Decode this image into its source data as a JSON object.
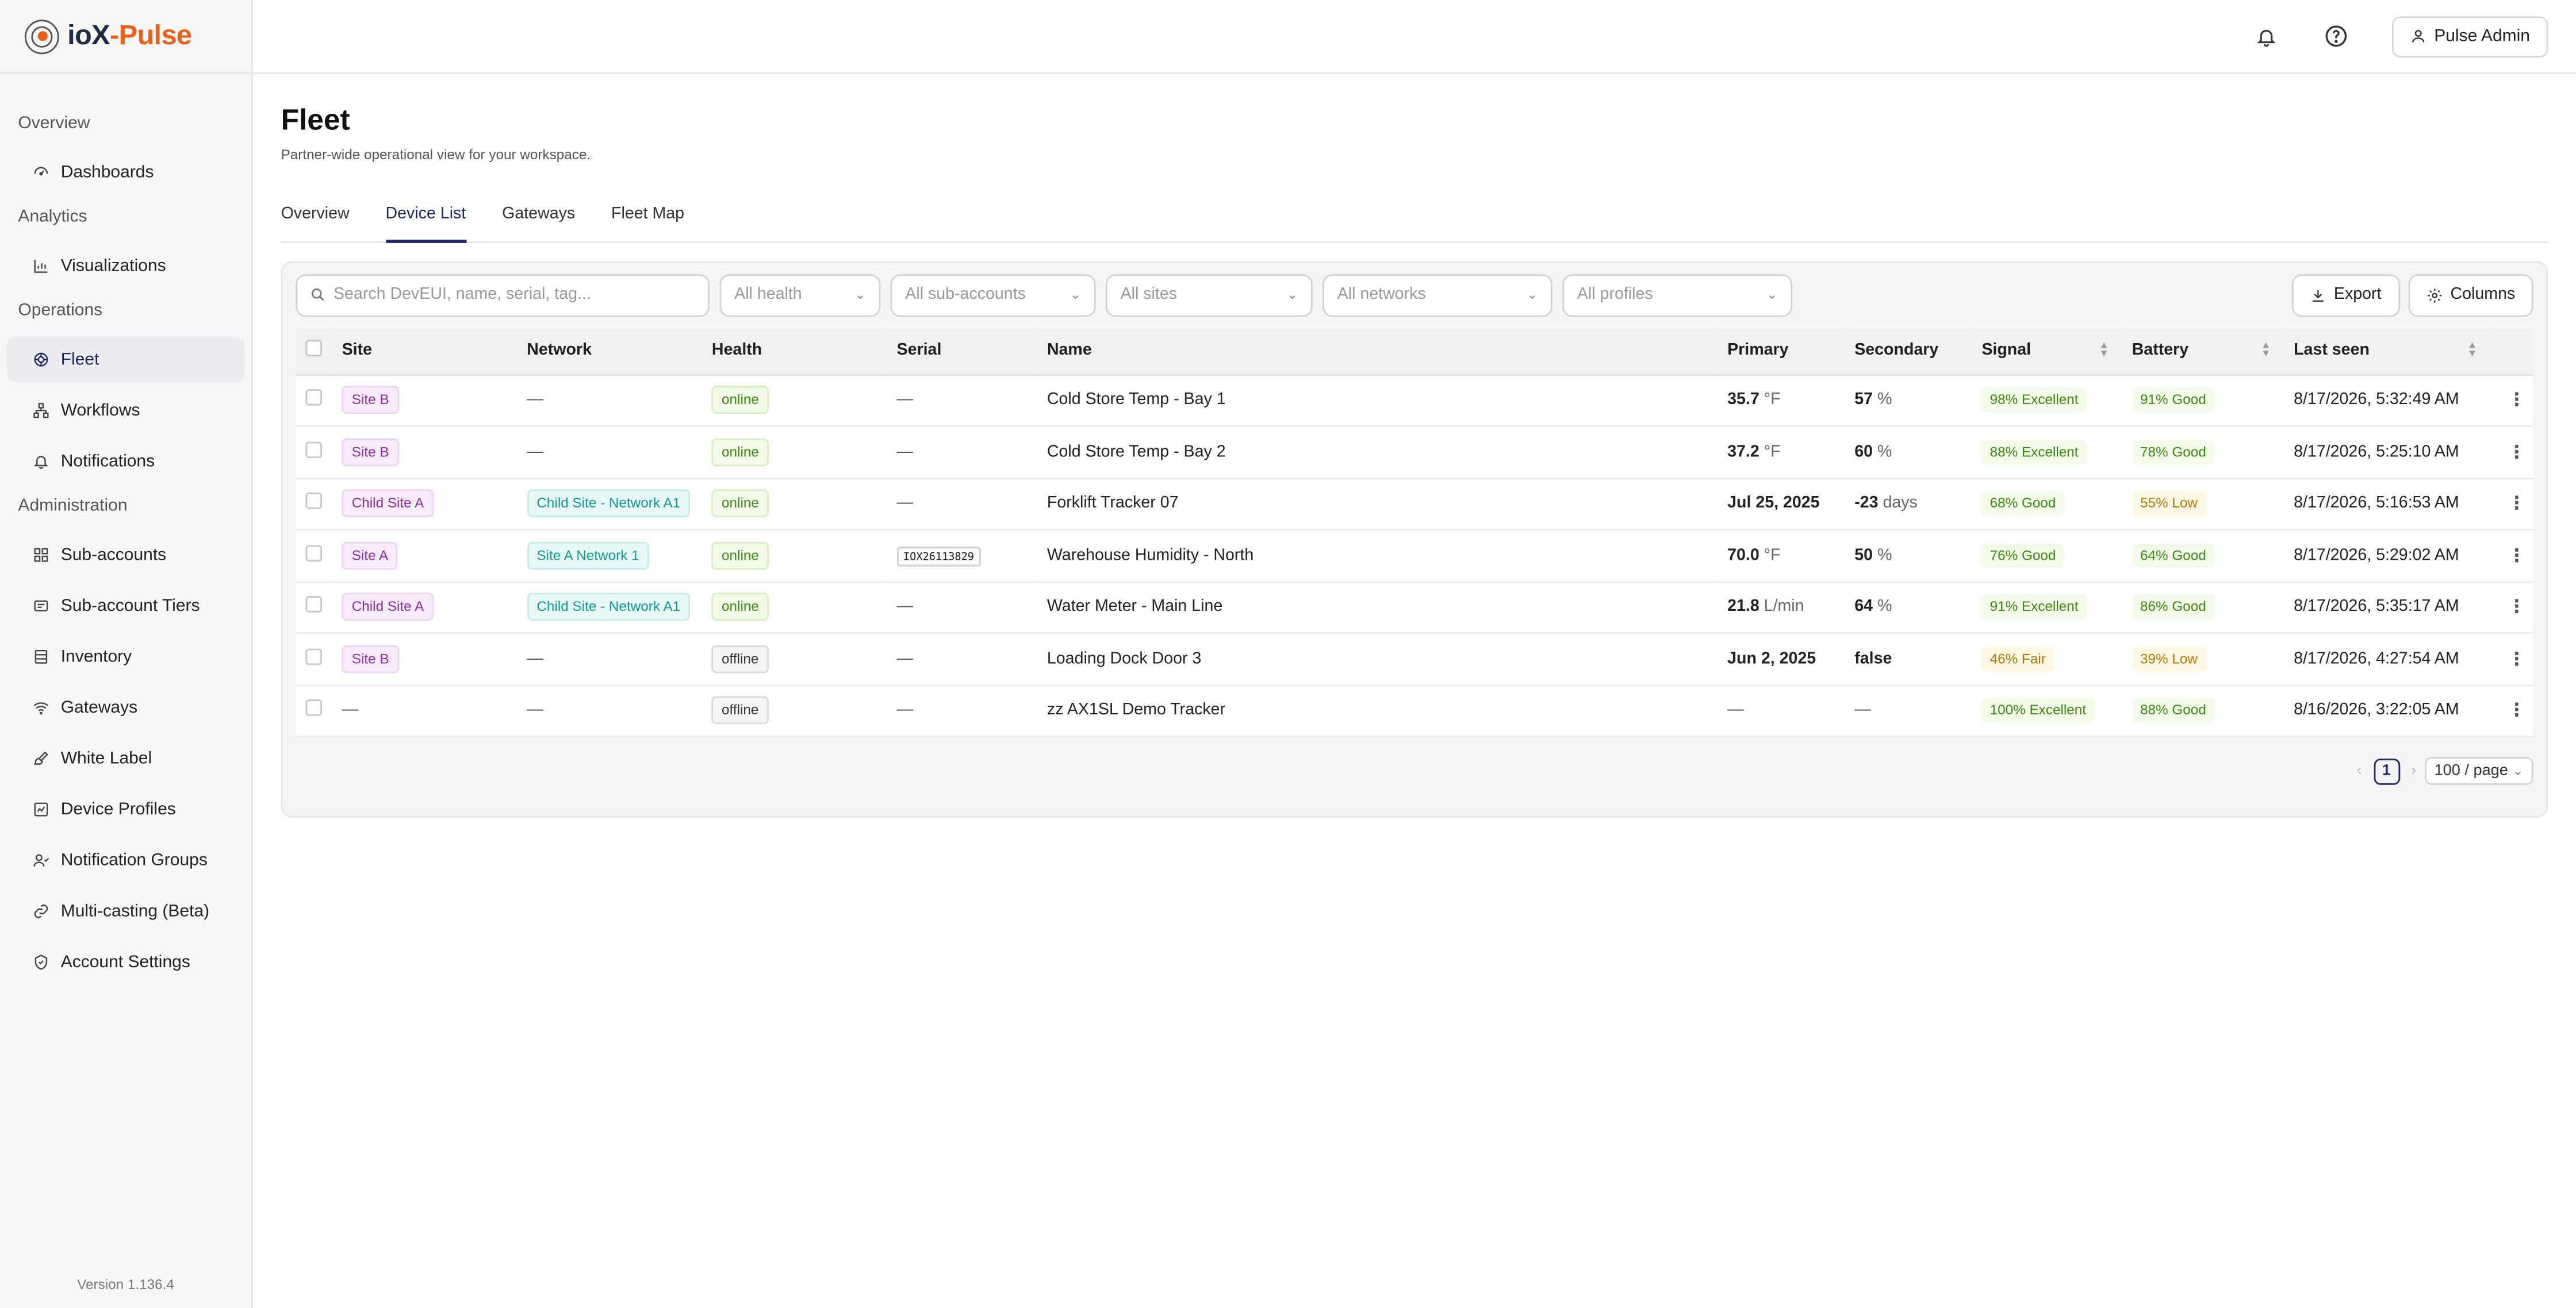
{
  "brand": {
    "part1": "ioX",
    "part2": "-Pulse"
  },
  "sidebar": {
    "sections": [
      {
        "title": "Overview",
        "items": [
          {
            "label": "Dashboards",
            "icon": "dashboard-icon"
          }
        ]
      },
      {
        "title": "Analytics",
        "items": [
          {
            "label": "Visualizations",
            "icon": "chart-icon"
          }
        ]
      },
      {
        "title": "Operations",
        "items": [
          {
            "label": "Fleet",
            "icon": "fleet-icon",
            "active": true
          },
          {
            "label": "Workflows",
            "icon": "workflow-icon"
          },
          {
            "label": "Notifications",
            "icon": "bell-icon"
          }
        ]
      },
      {
        "title": "Administration",
        "items": [
          {
            "label": "Sub-accounts",
            "icon": "grid-icon"
          },
          {
            "label": "Sub-account Tiers",
            "icon": "tiers-icon"
          },
          {
            "label": "Inventory",
            "icon": "inventory-icon"
          },
          {
            "label": "Gateways",
            "icon": "wifi-icon"
          },
          {
            "label": "White Label",
            "icon": "brush-icon"
          },
          {
            "label": "Device Profiles",
            "icon": "profile-icon"
          },
          {
            "label": "Notification Groups",
            "icon": "group-icon"
          },
          {
            "label": "Multi-casting (Beta)",
            "icon": "link-icon"
          },
          {
            "label": "Account Settings",
            "icon": "shield-icon"
          }
        ]
      }
    ],
    "version": "Version 1.136.4"
  },
  "topbar": {
    "user": "Pulse Admin"
  },
  "page": {
    "title": "Fleet",
    "subtitle": "Partner-wide operational view for your workspace."
  },
  "tabs": [
    {
      "label": "Overview",
      "active": false
    },
    {
      "label": "Device List",
      "active": true
    },
    {
      "label": "Gateways",
      "active": false
    },
    {
      "label": "Fleet Map",
      "active": false
    }
  ],
  "filters": {
    "search_placeholder": "Search DevEUI, name, serial, tag...",
    "health": "All health",
    "subaccounts": "All sub-accounts",
    "sites": "All sites",
    "networks": "All networks",
    "profiles": "All profiles",
    "export": "Export",
    "columns": "Columns"
  },
  "table": {
    "headers": [
      "Site",
      "Network",
      "Health",
      "Serial",
      "Name",
      "Primary",
      "Secondary",
      "Signal",
      "Battery",
      "Last seen"
    ],
    "rows": [
      {
        "site": "Site B",
        "network": "—",
        "health": "online",
        "serial": "—",
        "name": "Cold Store Temp - Bay 1",
        "primary": "35.7",
        "primary_unit": "°F",
        "secondary": "57",
        "secondary_unit": "%",
        "signal": "98% Excellent",
        "signal_level": "good",
        "battery": "91% Good",
        "battery_level": "good",
        "last_seen": "8/17/2026, 5:32:49 AM"
      },
      {
        "site": "Site B",
        "network": "—",
        "health": "online",
        "serial": "—",
        "name": "Cold Store Temp - Bay 2",
        "primary": "37.2",
        "primary_unit": "°F",
        "secondary": "60",
        "secondary_unit": "%",
        "signal": "88% Excellent",
        "signal_level": "good",
        "battery": "78% Good",
        "battery_level": "good",
        "last_seen": "8/17/2026, 5:25:10 AM"
      },
      {
        "site": "Child Site A",
        "network": "Child Site - Network A1",
        "health": "online",
        "serial": "—",
        "name": "Forklift Tracker 07",
        "primary": "Jul 25, 2025",
        "primary_unit": "",
        "secondary": "-23",
        "secondary_unit": "days",
        "signal": "68% Good",
        "signal_level": "good",
        "battery": "55% Low",
        "battery_level": "low",
        "last_seen": "8/17/2026, 5:16:53 AM"
      },
      {
        "site": "Site A",
        "network": "Site A Network 1",
        "health": "online",
        "serial": "IOX26113829",
        "name": "Warehouse Humidity - North",
        "primary": "70.0",
        "primary_unit": "°F",
        "secondary": "50",
        "secondary_unit": "%",
        "signal": "76% Good",
        "signal_level": "good",
        "battery": "64% Good",
        "battery_level": "good",
        "last_seen": "8/17/2026, 5:29:02 AM"
      },
      {
        "site": "Child Site A",
        "network": "Child Site - Network A1",
        "health": "online",
        "serial": "—",
        "name": "Water Meter - Main Line",
        "primary": "21.8",
        "primary_unit": "L/min",
        "secondary": "64",
        "secondary_unit": "%",
        "signal": "91% Excellent",
        "signal_level": "good",
        "battery": "86% Good",
        "battery_level": "good",
        "last_seen": "8/17/2026, 5:35:17 AM"
      },
      {
        "site": "Site B",
        "network": "—",
        "health": "offline",
        "serial": "—",
        "name": "Loading Dock Door 3",
        "primary": "Jun 2, 2025",
        "primary_unit": "",
        "secondary": "false",
        "secondary_unit": "",
        "signal": "46% Fair",
        "signal_level": "fair",
        "battery": "39% Low",
        "battery_level": "low",
        "last_seen": "8/17/2026, 4:27:54 AM"
      },
      {
        "site": "—",
        "network": "—",
        "health": "offline",
        "serial": "—",
        "name": "zz AX1SL Demo Tracker",
        "primary": "—",
        "primary_unit": "",
        "secondary": "—",
        "secondary_unit": "",
        "signal": "100% Excellent",
        "signal_level": "good",
        "battery": "88% Good",
        "battery_level": "good",
        "last_seen": "8/16/2026, 3:22:05 AM"
      }
    ]
  },
  "pagination": {
    "current": "1",
    "per_page": "100 / page"
  }
}
